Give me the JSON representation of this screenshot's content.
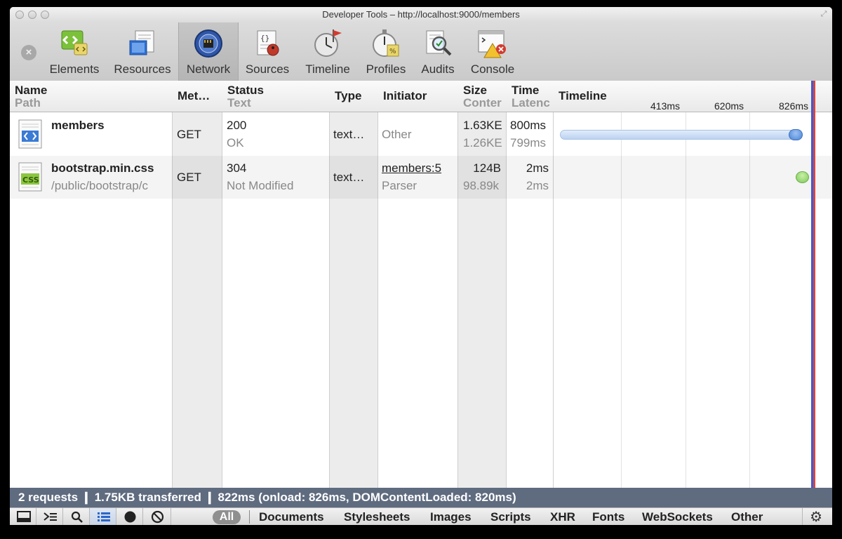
{
  "window": {
    "title": "Developer Tools – http://localhost:9000/members"
  },
  "toolbar": {
    "tabs": [
      {
        "label": "Elements",
        "icon": "elements-icon"
      },
      {
        "label": "Resources",
        "icon": "resources-icon"
      },
      {
        "label": "Network",
        "icon": "network-icon",
        "selected": true
      },
      {
        "label": "Sources",
        "icon": "sources-icon"
      },
      {
        "label": "Timeline",
        "icon": "timeline-icon"
      },
      {
        "label": "Profiles",
        "icon": "profiles-icon"
      },
      {
        "label": "Audits",
        "icon": "audits-icon"
      },
      {
        "label": "Console",
        "icon": "console-icon"
      }
    ]
  },
  "columns": {
    "name": {
      "title": "Name",
      "subtitle": "Path"
    },
    "method": {
      "title": "Met…"
    },
    "status": {
      "title": "Status",
      "subtitle": "Text"
    },
    "type": {
      "title": "Type"
    },
    "initiator": {
      "title": "Initiator"
    },
    "size": {
      "title": "Size",
      "subtitle": "Conter"
    },
    "time": {
      "title": "Time",
      "subtitle": "Latenc"
    },
    "timeline": {
      "title": "Timeline",
      "ticks": [
        "413ms",
        "620ms",
        "826ms"
      ]
    }
  },
  "requests": [
    {
      "name": "members",
      "path": "",
      "method": "GET",
      "status": "200",
      "status_text": "OK",
      "type": "text…",
      "initiator": "Other",
      "initiator_sub": "",
      "size": "1.63KE",
      "content": "1.26KE",
      "time": "800ms",
      "latency": "799ms",
      "icon": "html-file-icon"
    },
    {
      "name": "bootstrap.min.css",
      "path": "/public/bootstrap/c",
      "method": "GET",
      "status": "304",
      "status_text": "Not Modified",
      "type": "text…",
      "initiator": "members:5",
      "initiator_sub": "Parser",
      "size": "124B",
      "content": "98.89k",
      "time": "2ms",
      "latency": "2ms",
      "icon": "css-file-icon"
    }
  ],
  "summary": "2 requests  ❙  1.75KB transferred  ❙  822ms (onload: 826ms, DOMContentLoaded: 820ms)",
  "statusbar": {
    "filters": [
      "All",
      "Documents",
      "Stylesheets",
      "Images",
      "Scripts",
      "XHR",
      "Fonts",
      "WebSockets",
      "Other"
    ],
    "active_filter": "All"
  },
  "colors": {
    "summary_bg": "#5f6b7f",
    "marker_blue": "#3b5bd8",
    "marker_red": "#d9463f"
  }
}
